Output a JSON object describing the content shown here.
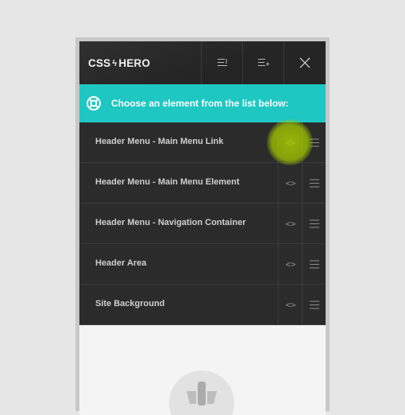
{
  "app": {
    "logo_left": "CSS",
    "logo_bolt": "ϟ",
    "logo_right": "HERO"
  },
  "toolbar": {
    "buttons": [
      {
        "icon": "collapse-list-icon"
      },
      {
        "icon": "expand-list-icon"
      },
      {
        "icon": "close-icon"
      }
    ]
  },
  "banner": {
    "icon": "lifebuoy-icon",
    "text": "Choose an element from the list below:",
    "color": "#1fc7c2"
  },
  "elements": [
    {
      "label": "Header Menu - Main Menu Link",
      "code": "<>"
    },
    {
      "label": "Header Menu - Main Menu Element",
      "code": "<>"
    },
    {
      "label": "Header Menu - Navigation Container",
      "code": "<>"
    },
    {
      "label": "Header Area",
      "code": "<>"
    },
    {
      "label": "Site Background",
      "code": "<>"
    }
  ]
}
